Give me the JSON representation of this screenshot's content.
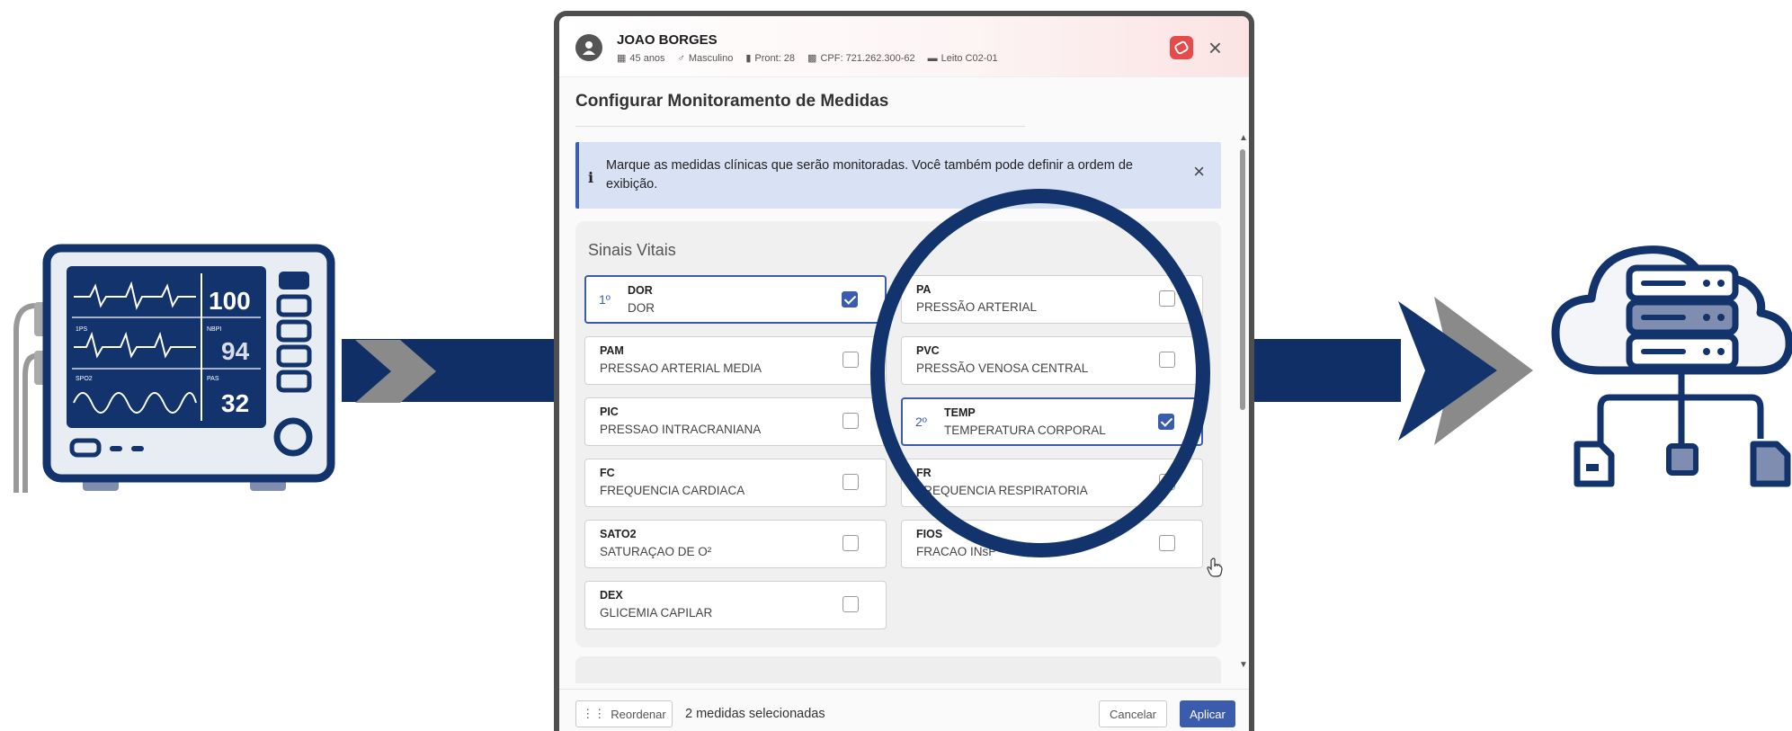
{
  "colors": {
    "navy": "#12336b",
    "accent": "#3b5cad",
    "info_bg": "#d9e1f5",
    "alert": "#e74a4a"
  },
  "monitor": {
    "readings": [
      "100",
      "94",
      "32"
    ],
    "labels": [
      "1PS",
      "NBPI",
      "SPO2",
      "PAS"
    ]
  },
  "patient": {
    "name": "JOAO BORGES",
    "age": "45 anos",
    "sex": "Masculino",
    "record": "Pront: 28",
    "cpf": "CPF: 721.262.300-62",
    "bed": "Leito C02-01"
  },
  "modal": {
    "title": "Configurar Monitoramento de Medidas",
    "info_text": "Marque as medidas clínicas que serão monitoradas. Você também pode definir a ordem de exibição.",
    "info_icon": "i",
    "group_title": "Sinais Vitais",
    "measures": [
      {
        "code": "DOR",
        "name": "DOR",
        "order": "1º",
        "checked": true
      },
      {
        "code": "PA",
        "name": "PRESSÃO ARTERIAL",
        "order": "",
        "checked": false
      },
      {
        "code": "PAM",
        "name": "PRESSAO ARTERIAL MEDIA",
        "order": "",
        "checked": false
      },
      {
        "code": "PVC",
        "name": "PRESSÃO VENOSA CENTRAL",
        "order": "",
        "checked": false
      },
      {
        "code": "PIC",
        "name": "PRESSAO INTRACRANIANA",
        "order": "",
        "checked": false
      },
      {
        "code": "TEMP",
        "name": "TEMPERATURA CORPORAL",
        "order": "2º",
        "checked": true
      },
      {
        "code": "FC",
        "name": "FREQUENCIA CARDIACA",
        "order": "",
        "checked": false
      },
      {
        "code": "FR",
        "name": "FREQUENCIA RESPIRATORIA",
        "order": "",
        "checked": false
      },
      {
        "code": "SATO2",
        "name": "SATURAÇAO DE O²",
        "order": "",
        "checked": false
      },
      {
        "code": "FIOS",
        "name": "FRACAO INsP",
        "order": "",
        "checked": false
      },
      {
        "code": "DEX",
        "name": "GLICEMIA CAPILAR",
        "order": "",
        "checked": false
      }
    ]
  },
  "footer": {
    "reorder_label": "Reordenar",
    "selected_count": "2 medidas selecionadas",
    "cancel_label": "Cancelar",
    "apply_label": "Aplicar"
  }
}
